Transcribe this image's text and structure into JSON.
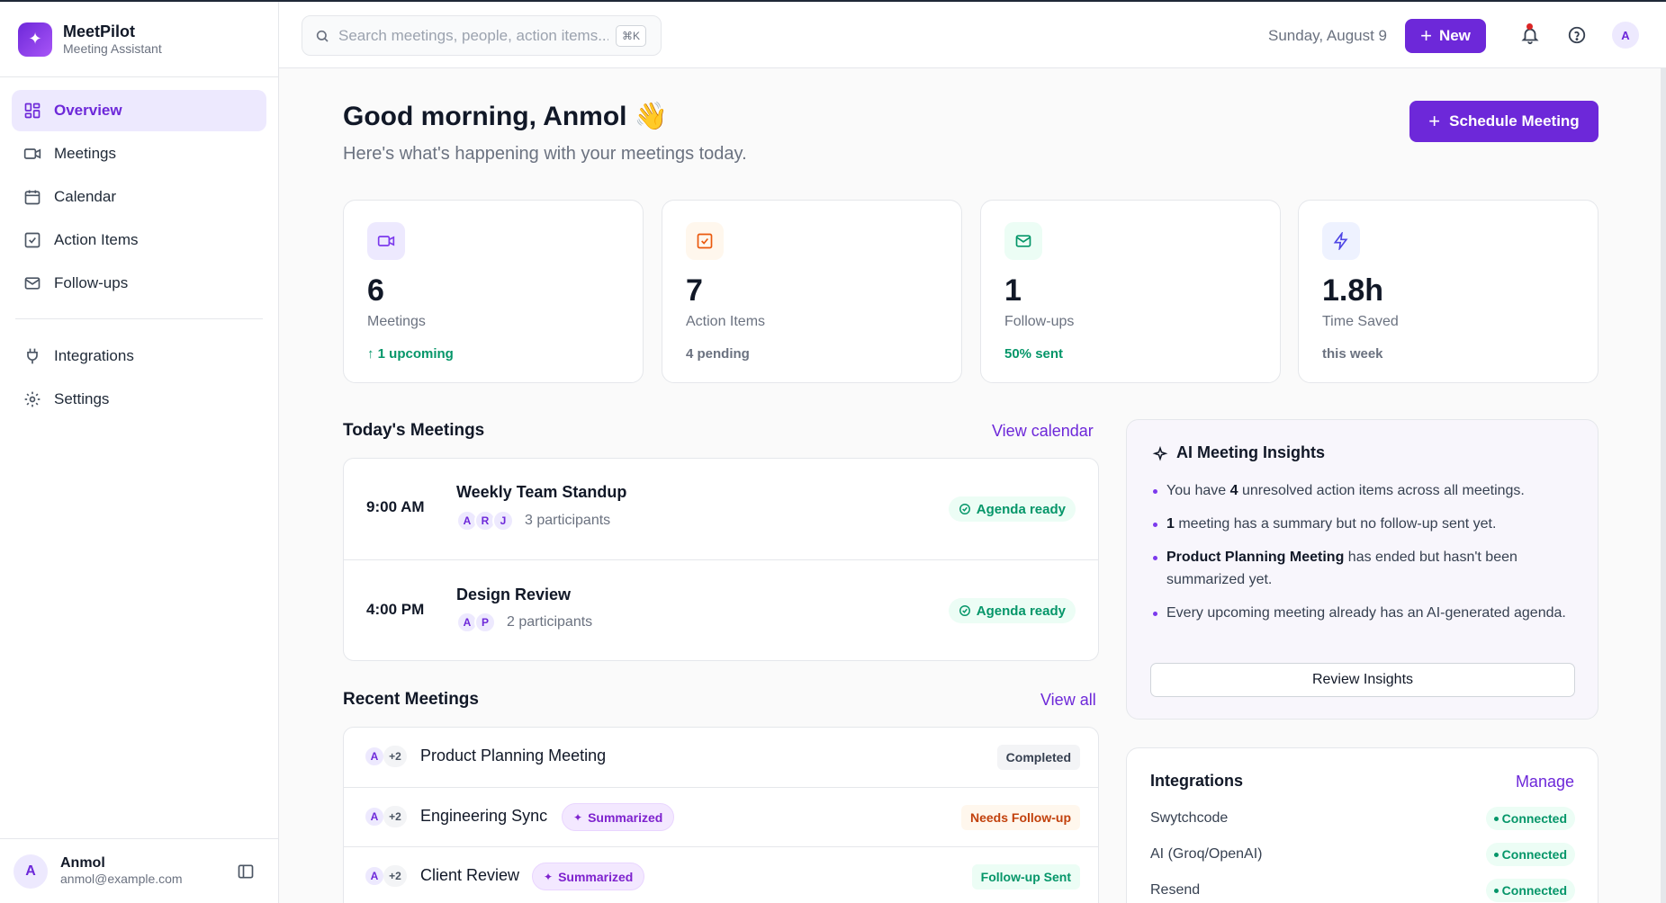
{
  "brand": {
    "name": "MeetPilot",
    "subtitle": "Meeting Assistant"
  },
  "sidebar": {
    "items": [
      {
        "label": "Overview",
        "icon": "grid-icon",
        "active": true
      },
      {
        "label": "Meetings",
        "icon": "video-icon"
      },
      {
        "label": "Calendar",
        "icon": "calendar-icon"
      },
      {
        "label": "Action Items",
        "icon": "check-square-icon"
      },
      {
        "label": "Follow-ups",
        "icon": "mail-icon"
      }
    ],
    "secondary": [
      {
        "label": "Integrations",
        "icon": "plug-icon"
      },
      {
        "label": "Settings",
        "icon": "gear-icon"
      }
    ],
    "user": {
      "initial": "A",
      "name": "Anmol",
      "email": "anmol@example.com"
    }
  },
  "header": {
    "search_placeholder": "Search meetings, people, action items...",
    "shortcut": "⌘K",
    "date": "Sunday, August 9",
    "new_label": "New",
    "avatar_initial": "A"
  },
  "greeting": {
    "title": "Good morning, Anmol 👋",
    "subtitle": "Here's what's happening with your meetings today.",
    "schedule_label": "Schedule Meeting"
  },
  "stats": [
    {
      "value": "6",
      "label": "Meetings",
      "foot": "↑ 1 upcoming",
      "icon": "video-icon",
      "icon_bg": "#ede9fe",
      "icon_color": "#7c3aed",
      "foot_color": "#059669"
    },
    {
      "value": "7",
      "label": "Action Items",
      "foot": "4 pending",
      "icon": "check-square-icon",
      "icon_bg": "#fff7ed",
      "icon_color": "#ea580c",
      "foot_color": "#6b7280"
    },
    {
      "value": "1",
      "label": "Follow-ups",
      "foot": "50% sent",
      "icon": "mail-icon",
      "icon_bg": "#ecfdf5",
      "icon_color": "#059669",
      "foot_color": "#059669"
    },
    {
      "value": "1.8h",
      "label": "Time Saved",
      "foot": "this week",
      "icon": "zap-icon",
      "icon_bg": "#eef2ff",
      "icon_color": "#4f46e5",
      "foot_color": "#6b7280"
    }
  ],
  "today": {
    "title": "Today's Meetings",
    "link": "View calendar",
    "meetings": [
      {
        "time": "9:00 AM",
        "title": "Weekly Team Standup",
        "avatars": [
          "A",
          "R",
          "J"
        ],
        "participants": "3 participants",
        "status": "Agenda ready"
      },
      {
        "time": "4:00 PM",
        "title": "Design Review",
        "avatars": [
          "A",
          "P"
        ],
        "participants": "2 participants",
        "status": "Agenda ready"
      }
    ]
  },
  "recent": {
    "title": "Recent Meetings",
    "link": "View all",
    "meetings": [
      {
        "avatar": "A",
        "more": "+2",
        "title": "Product Planning Meeting",
        "tag": "",
        "status": "Completed",
        "status_bg": "#f3f4f6",
        "status_color": "#374151"
      },
      {
        "avatar": "A",
        "more": "+2",
        "title": "Engineering Sync",
        "tag": "Summarized",
        "status": "Needs Follow-up",
        "status_bg": "#fff7ed",
        "status_color": "#c2410c"
      },
      {
        "avatar": "A",
        "more": "+2",
        "title": "Client Review",
        "tag": "Summarized",
        "status": "Follow-up Sent",
        "status_bg": "#ecfdf5",
        "status_color": "#059669"
      }
    ]
  },
  "insights": {
    "title": "AI Meeting Insights",
    "items": [
      {
        "before": "You have ",
        "bold": "4",
        "after": " unresolved action items across all meetings."
      },
      {
        "before": "",
        "bold": "1",
        "after": " meeting has a summary but no follow-up sent yet."
      },
      {
        "before": "",
        "bold": "Product Planning Meeting",
        "after": " has ended but hasn't been summarized yet."
      },
      {
        "before": "Every upcoming meeting already has an AI-generated agenda.",
        "bold": "",
        "after": ""
      }
    ],
    "button": "Review Insights"
  },
  "integrations": {
    "title": "Integrations",
    "link": "Manage",
    "items": [
      {
        "name": "Swytchcode",
        "status": "Connected"
      },
      {
        "name": "AI (Groq/OpenAI)",
        "status": "Connected"
      },
      {
        "name": "Resend",
        "status": "Connected"
      }
    ]
  },
  "colors": {
    "accent": "#6d28d9",
    "success": "#059669",
    "warning": "#c2410c"
  }
}
